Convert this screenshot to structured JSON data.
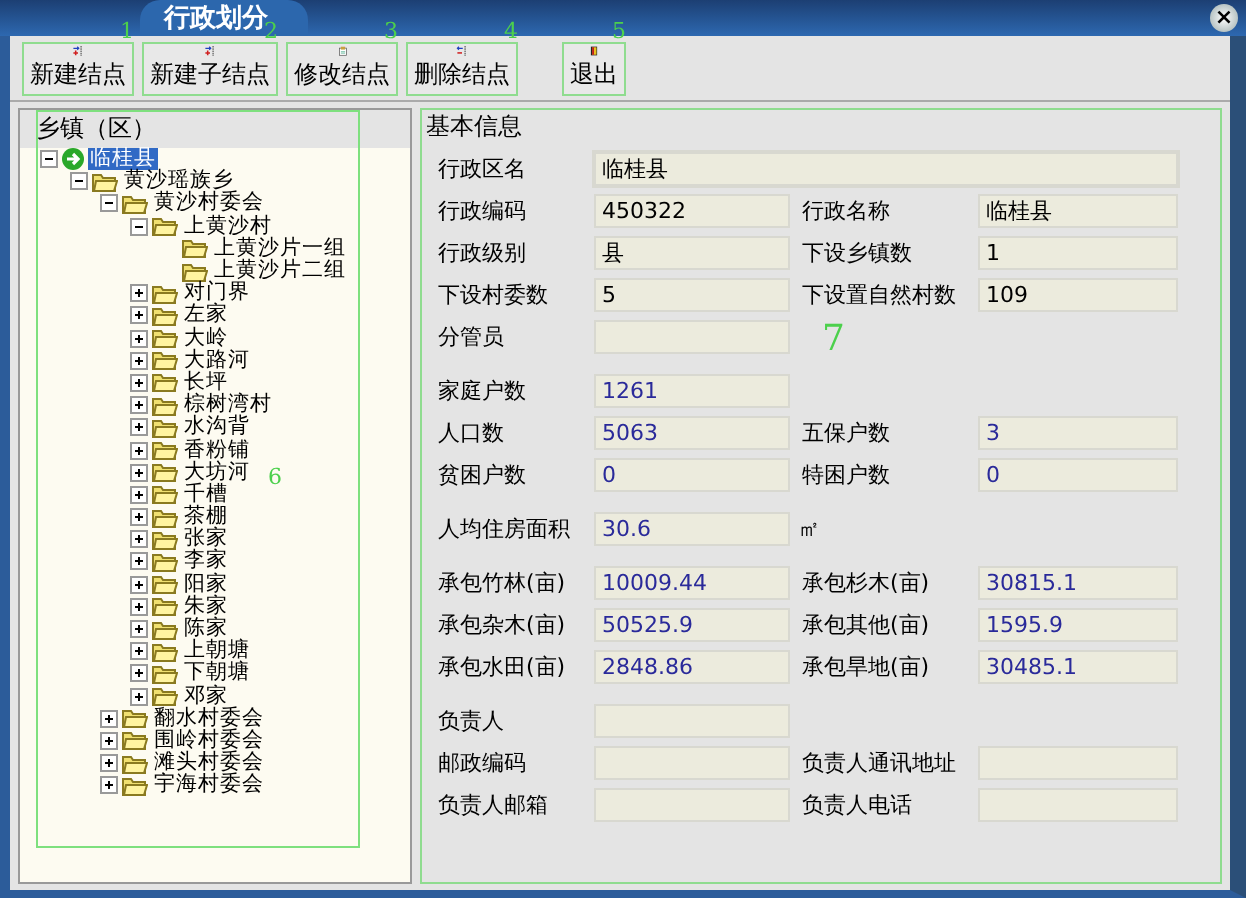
{
  "window": {
    "title": "行政划分",
    "close": "×"
  },
  "toolbar": [
    {
      "label": "新建结点",
      "kind": "add",
      "marker": "1"
    },
    {
      "label": "新建子结点",
      "kind": "add",
      "marker": "2"
    },
    {
      "label": "修改结点",
      "kind": "edit",
      "marker": "3"
    },
    {
      "label": "删除结点",
      "kind": "remove",
      "marker": "4"
    },
    {
      "label": "退出",
      "kind": "exit",
      "marker": "5"
    }
  ],
  "tree_panel": {
    "title": "乡镇（区）",
    "marker": "6",
    "items": [
      {
        "label": "临桂县",
        "kind": "root",
        "expanded": true,
        "selected": true,
        "children": [
          {
            "label": "黄沙瑶族乡",
            "kind": "folder",
            "expanded": true,
            "selected": false,
            "children": [
              {
                "label": "黄沙村委会",
                "kind": "folder",
                "expanded": true,
                "selected": false,
                "children": [
                  {
                    "label": "上黄沙村",
                    "kind": "folder",
                    "expanded": true,
                    "selected": false,
                    "children": [
                      {
                        "label": "上黄沙片一组",
                        "kind": "folder",
                        "selected": false
                      },
                      {
                        "label": "上黄沙片二组",
                        "kind": "folder",
                        "selected": false
                      }
                    ]
                  },
                  {
                    "label": "对门界",
                    "kind": "folder",
                    "expanded": false,
                    "selected": false
                  },
                  {
                    "label": "左家",
                    "kind": "folder",
                    "expanded": false,
                    "selected": false
                  },
                  {
                    "label": "大岭",
                    "kind": "folder",
                    "expanded": false,
                    "selected": false
                  },
                  {
                    "label": "大路河",
                    "kind": "folder",
                    "expanded": false,
                    "selected": false
                  },
                  {
                    "label": "长坪",
                    "kind": "folder",
                    "expanded": false,
                    "selected": false
                  },
                  {
                    "label": "棕树湾村",
                    "kind": "folder",
                    "expanded": false,
                    "selected": false
                  },
                  {
                    "label": "水沟背",
                    "kind": "folder",
                    "expanded": false,
                    "selected": false
                  },
                  {
                    "label": "香粉铺",
                    "kind": "folder",
                    "expanded": false,
                    "selected": false
                  },
                  {
                    "label": "大坊河",
                    "kind": "folder",
                    "expanded": false,
                    "selected": false
                  },
                  {
                    "label": "千槽",
                    "kind": "folder",
                    "expanded": false,
                    "selected": false
                  },
                  {
                    "label": "茶棚",
                    "kind": "folder",
                    "expanded": false,
                    "selected": false
                  },
                  {
                    "label": "张家",
                    "kind": "folder",
                    "expanded": false,
                    "selected": false
                  },
                  {
                    "label": "李家",
                    "kind": "folder",
                    "expanded": false,
                    "selected": false
                  },
                  {
                    "label": "阳家",
                    "kind": "folder",
                    "expanded": false,
                    "selected": false
                  },
                  {
                    "label": "朱家",
                    "kind": "folder",
                    "expanded": false,
                    "selected": false
                  },
                  {
                    "label": "陈家",
                    "kind": "folder",
                    "expanded": false,
                    "selected": false
                  },
                  {
                    "label": "上朝塘",
                    "kind": "folder",
                    "expanded": false,
                    "selected": false
                  },
                  {
                    "label": "下朝塘",
                    "kind": "folder",
                    "expanded": false,
                    "selected": false
                  },
                  {
                    "label": "邓家",
                    "kind": "folder",
                    "expanded": false,
                    "selected": false
                  }
                ]
              },
              {
                "label": "翻水村委会",
                "kind": "folder",
                "expanded": false,
                "selected": false
              },
              {
                "label": "围岭村委会",
                "kind": "folder",
                "expanded": false,
                "selected": false
              },
              {
                "label": "滩头村委会",
                "kind": "folder",
                "expanded": false,
                "selected": false
              },
              {
                "label": "宇海村委会",
                "kind": "folder",
                "expanded": false,
                "selected": false
              }
            ]
          }
        ]
      }
    ]
  },
  "info_panel": {
    "title": "基本信息",
    "marker": "7",
    "sections": [
      {
        "kind": "plain",
        "rows": [
          [
            {
              "label": "行政区名",
              "value": "临桂县",
              "wide": true
            }
          ],
          [
            {
              "label": "行政编码",
              "value": "450322"
            },
            {
              "label": "行政名称",
              "value": "临桂县"
            }
          ],
          [
            {
              "label": "行政级别",
              "value": "县"
            },
            {
              "label": "下设乡镇数",
              "value": "1"
            }
          ],
          [
            {
              "label": "下设村委数",
              "value": "5"
            },
            {
              "label": "下设置自然村数",
              "value": "109"
            }
          ],
          [
            {
              "label": "分管员"
            }
          ]
        ]
      },
      {
        "kind": "statistic",
        "rows": [
          [
            {
              "label": "家庭户数",
              "value": "1261"
            }
          ],
          [
            {
              "label": "人口数",
              "value": "5063"
            },
            {
              "label": "五保户数",
              "value": "3"
            }
          ],
          [
            {
              "label": "贫困户数",
              "value": "0"
            },
            {
              "label": "特困户数",
              "value": "0"
            }
          ]
        ]
      },
      {
        "kind": "statistic",
        "rows": [
          [
            {
              "label": "人均住房面积",
              "value": "30.6",
              "unit": "㎡"
            }
          ]
        ]
      },
      {
        "kind": "statistic",
        "rows": [
          [
            {
              "label": "承包竹林(亩)",
              "value": "10009.44"
            },
            {
              "label": "承包杉木(亩)",
              "value": "30815.1"
            }
          ],
          [
            {
              "label": "承包杂木(亩)",
              "value": "50525.9"
            },
            {
              "label": "承包其他(亩)",
              "value": "1595.9"
            }
          ],
          [
            {
              "label": "承包水田(亩)",
              "value": "2848.86"
            },
            {
              "label": "承包旱地(亩)",
              "value": "30485.1"
            }
          ]
        ]
      },
      {
        "kind": "plain",
        "rows": [
          [
            {
              "label": "负责人"
            }
          ],
          [
            {
              "label": "邮政编码"
            },
            {
              "label": "负责人通讯地址"
            }
          ],
          [
            {
              "label": "负责人邮箱"
            },
            {
              "label": "负责人电话"
            }
          ]
        ]
      }
    ]
  }
}
